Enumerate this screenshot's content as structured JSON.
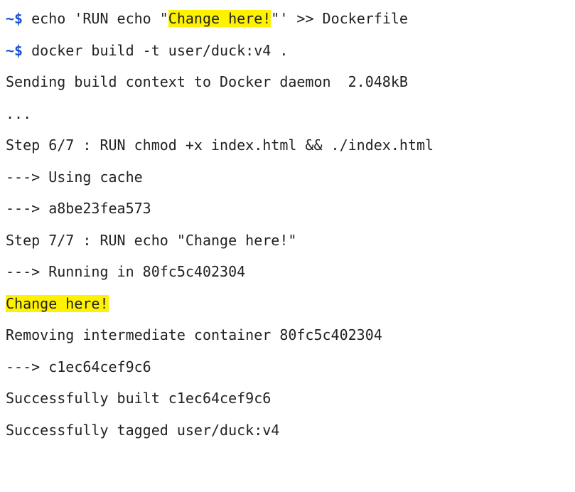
{
  "colors": {
    "prompt": "#1a4fd6",
    "text": "#222222",
    "highlight": "#fff200",
    "background": "#ffffff"
  },
  "terminal": {
    "lines": [
      {
        "prompt": "~$",
        "before": " echo 'RUN echo \"",
        "highlight": "Change here!",
        "after": "\"' >> Dockerfile"
      },
      {
        "prompt": "~$",
        "text": " docker build -t user/duck:v4 ."
      },
      {
        "text": "Sending build context to Docker daemon  2.048kB"
      },
      {
        "text": "..."
      },
      {
        "text": "Step 6/7 : RUN chmod +x index.html && ./index.html"
      },
      {
        "text": "---> Using cache"
      },
      {
        "text": "---> a8be23fea573"
      },
      {
        "text": "Step 7/7 : RUN echo \"Change here!\""
      },
      {
        "text": "---> Running in 80fc5c402304"
      },
      {
        "highlight": "Change here!"
      },
      {
        "text": "Removing intermediate container 80fc5c402304"
      },
      {
        "text": "---> c1ec64cef9c6"
      },
      {
        "text": "Successfully built c1ec64cef9c6"
      },
      {
        "text": "Successfully tagged user/duck:v4"
      }
    ]
  }
}
